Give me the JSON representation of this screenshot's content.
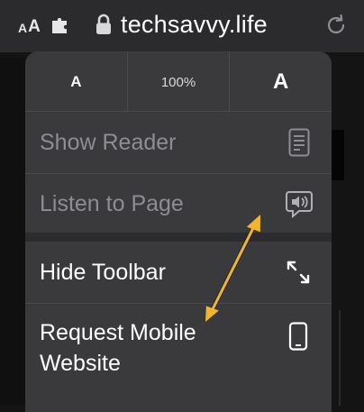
{
  "address_bar": {
    "aa_small": "A",
    "aa_large": "A",
    "url": "techsavvy.life",
    "icons": {
      "extension": "puzzle-piece-icon",
      "lock": "lock-icon",
      "reload": "reload-icon"
    }
  },
  "menu": {
    "zoom": {
      "decrease_label": "A",
      "level": "100%",
      "increase_label": "A"
    },
    "items": [
      {
        "label": "Show Reader",
        "icon": "reader-icon",
        "enabled": false
      },
      {
        "label": "Listen to Page",
        "icon": "speaker-bubble-icon",
        "enabled": false
      },
      {
        "label": "Hide Toolbar",
        "icon": "expand-arrows-icon",
        "enabled": true
      },
      {
        "label": "Request Mobile Website",
        "icon": "mobile-phone-icon",
        "enabled": true
      }
    ]
  },
  "annotation": {
    "arrow_color": "#f2b530"
  }
}
